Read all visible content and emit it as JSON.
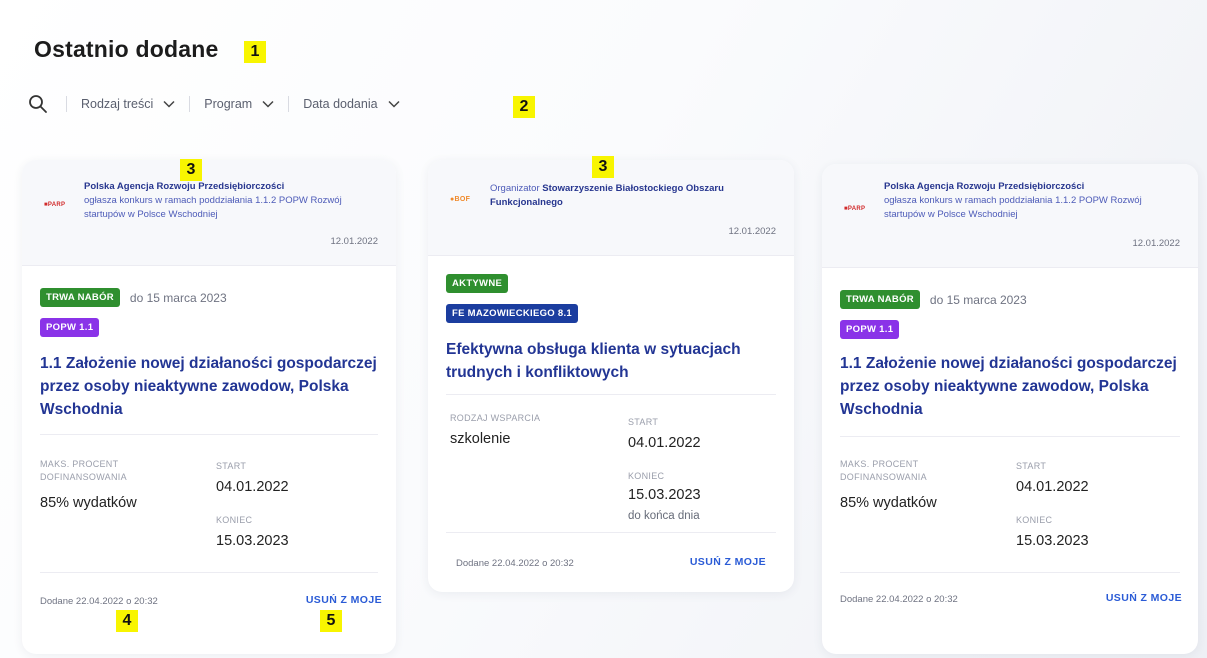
{
  "page": {
    "title": "Ostatnio dodane"
  },
  "markers": [
    "1",
    "2",
    "3",
    "3",
    "4",
    "5"
  ],
  "filters": [
    {
      "label": "Rodzaj treści"
    },
    {
      "label": "Program"
    },
    {
      "label": "Data dodania"
    }
  ],
  "cards": [
    {
      "org_name": "Polska Agencja Rozwoju Przedsiębiorczości",
      "org_text": "ogłasza konkurs w ramach poddziałania 1.1.2 POPW Rozwój startupów w Polsce Wschodniej",
      "head_date": "12.01.2022",
      "status": "TRWA NABÓR",
      "deadline": "do 15 marca 2023",
      "program": "POPW 1.1",
      "title": "1.1 Założenie nowej działaności gospodarczej przez osoby nieaktywne zawodow, Polska Wschodnia",
      "left_label": "MAKS. PROCENT DOFINANSOWANIA",
      "left_value": "85% wydatków",
      "start_label": "START",
      "start_value": "04.01.2022",
      "end_label": "KONIEC",
      "end_value": "15.03.2023",
      "added": "Dodane 22.04.2022 o 20:32",
      "remove": "USUŃ Z MOJE"
    },
    {
      "org_prefix": "Organizator",
      "org_name": "Stowarzyszenie Białostockiego Obszaru Funkcjonalnego",
      "head_date": "12.01.2022",
      "status": "AKTYWNE",
      "program": "FE MAZOWIECKIEGO 8.1",
      "title": "Efektywna obsługa klienta w sytuacjach trudnych i konfliktowych",
      "left_label": "RODZAJ WSPARCIA",
      "left_value": "szkolenie",
      "start_label": "START",
      "start_value": "04.01.2022",
      "end_label": "KONIEC",
      "end_value": "15.03.2023",
      "end_note": "do końca dnia",
      "added": "Dodane 22.04.2022 o 20:32",
      "remove": "USUŃ Z MOJE"
    },
    {
      "org_name": "Polska Agencja Rozwoju Przedsiębiorczości",
      "org_text": "ogłasza konkurs w ramach poddziałania 1.1.2 POPW Rozwój startupów w Polsce Wschodniej",
      "head_date": "12.01.2022",
      "status": "TRWA NABÓR",
      "deadline": "do 15 marca 2023",
      "program": "POPW 1.1",
      "title": "1.1 Założenie nowej działaności gospodarczej przez osoby nieaktywne zawodow, Polska Wschodnia",
      "left_label": "MAKS. PROCENT DOFINANSOWANIA",
      "left_value": "85% wydatków",
      "start_label": "START",
      "start_value": "04.01.2022",
      "end_label": "KONIEC",
      "end_value": "15.03.2023",
      "added": "Dodane 22.04.2022 o 20:32",
      "remove": "USUŃ Z MOJE"
    }
  ],
  "colors": {
    "accent_title": "#223594",
    "badge_green": "#2f8f2f",
    "badge_purple": "#8a33e8",
    "badge_blue": "#1b3d9f",
    "link": "#2a5bd6",
    "marker": "#f8f500"
  },
  "icons": [
    "search-icon",
    "chevron-down-icon"
  ]
}
